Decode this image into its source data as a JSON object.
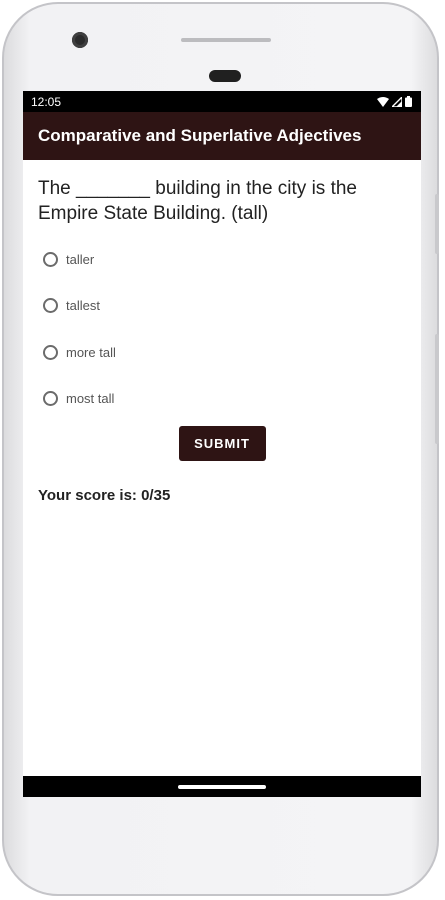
{
  "status_bar": {
    "time": "12:05",
    "icons": [
      "wifi-icon",
      "signal-icon",
      "battery-icon"
    ]
  },
  "app_bar": {
    "title": "Comparative and Superlative Adjectives",
    "color": "#2e1414"
  },
  "quiz": {
    "question": "The _______ building in the city is the Empire State Building. (tall)",
    "options": [
      {
        "label": "taller",
        "selected": false
      },
      {
        "label": "tallest",
        "selected": false
      },
      {
        "label": "more tall",
        "selected": false
      },
      {
        "label": "most tall",
        "selected": false
      }
    ],
    "submit_label": "SUBMIT",
    "score_text": "Your score is: 0/35"
  }
}
